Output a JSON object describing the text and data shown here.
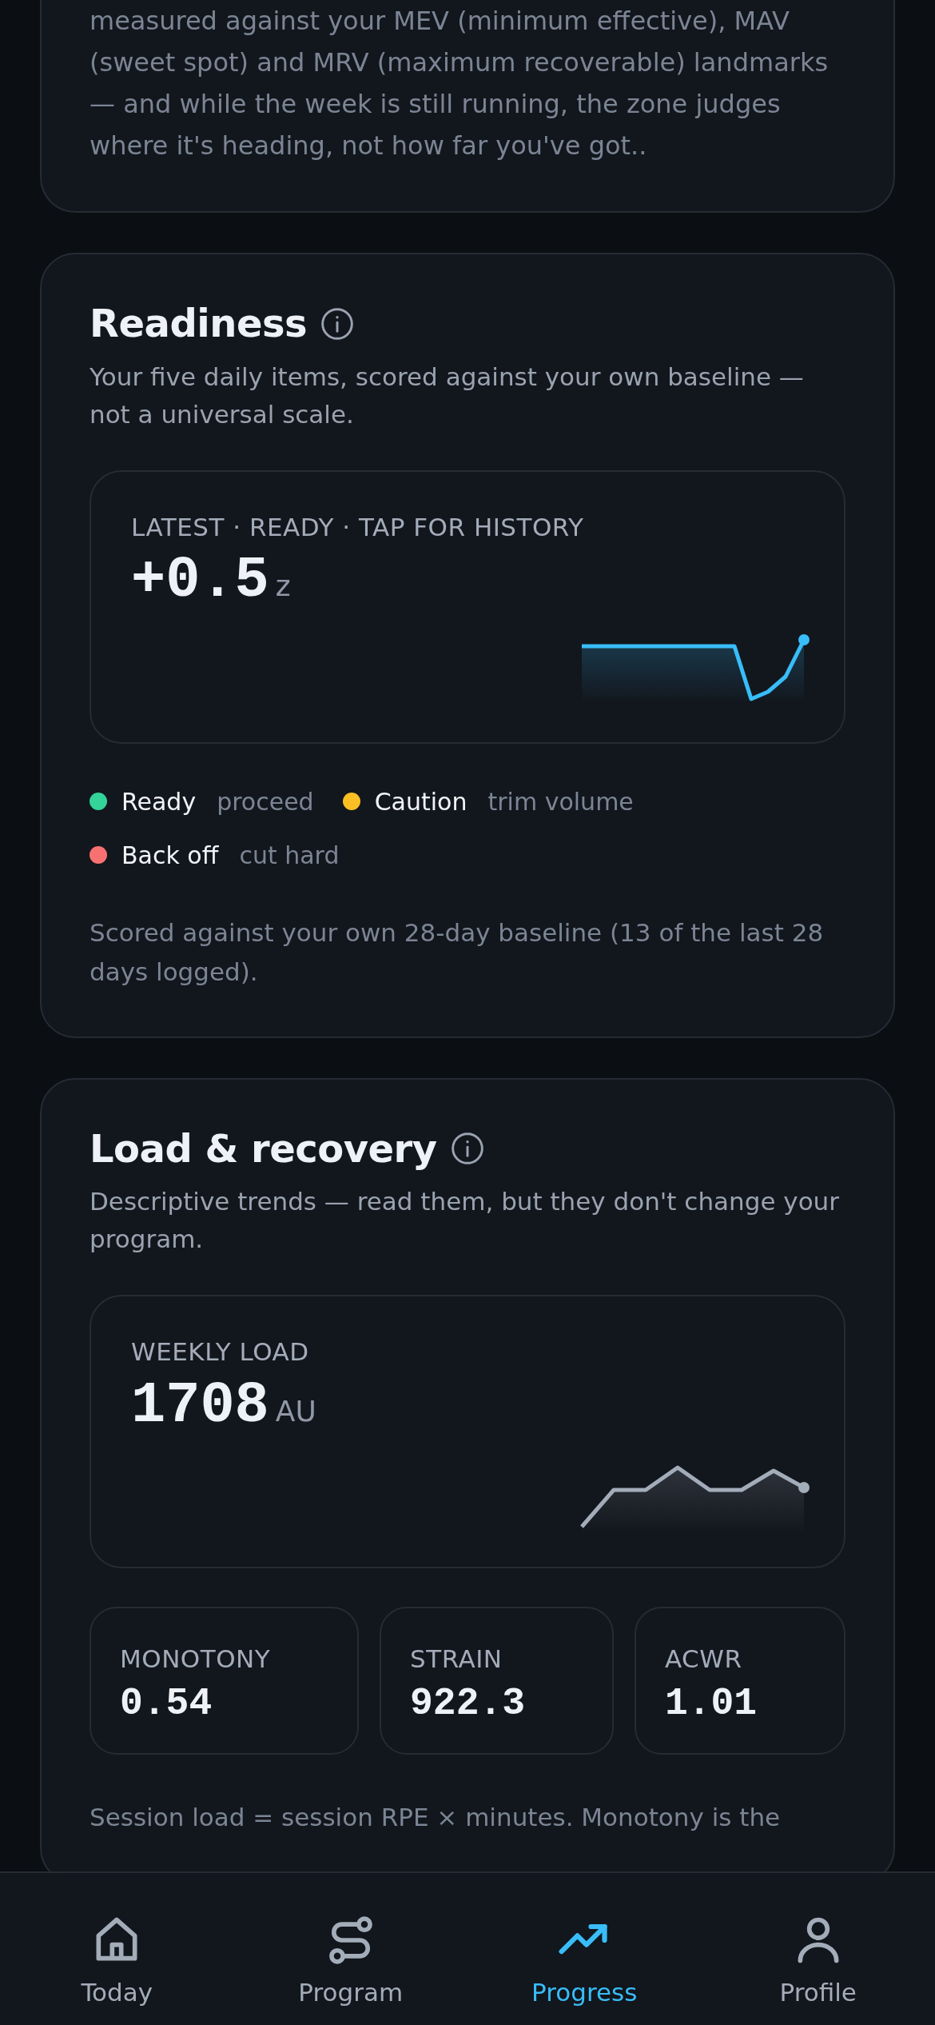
{
  "intro_card": {
    "text": "measured against your MEV (minimum effective), MAV (sweet spot) and MRV (maximum recoverable) landmarks — and while the week is still running, the zone judges where it's heading, not how far you've got.."
  },
  "readiness": {
    "title": "Readiness",
    "subtitle": "Your five daily items, scored against your own baseline — not a universal scale.",
    "metric": {
      "label": "LATEST · READY · TAP FOR HISTORY",
      "value": "+0.5",
      "unit": "z"
    },
    "legend": [
      {
        "label": "Ready",
        "hint": "proceed",
        "color": "#34d399"
      },
      {
        "label": "Caution",
        "hint": "trim volume",
        "color": "#fbbf24"
      },
      {
        "label": "Back off",
        "hint": "cut hard",
        "color": "#f87171"
      }
    ],
    "note": "Scored against your own 28-day baseline (13 of the last 28 days logged)."
  },
  "load": {
    "title": "Load & recovery",
    "subtitle": "Descriptive trends — read them, but they don't change your program.",
    "metric": {
      "label": "WEEKLY LOAD",
      "value": "1708",
      "unit": "AU"
    },
    "stats": [
      {
        "label": "MONOTONY",
        "value": "0.54"
      },
      {
        "label": "STRAIN",
        "value": "922.3"
      },
      {
        "label": "ACWR",
        "value": "1.01"
      }
    ],
    "note": "Session load = session RPE × minutes. Monotony is the"
  },
  "nav": [
    {
      "label": "Today",
      "selected": false
    },
    {
      "label": "Program",
      "selected": false
    },
    {
      "label": "Progress",
      "selected": true
    },
    {
      "label": "Profile",
      "selected": false
    }
  ]
}
